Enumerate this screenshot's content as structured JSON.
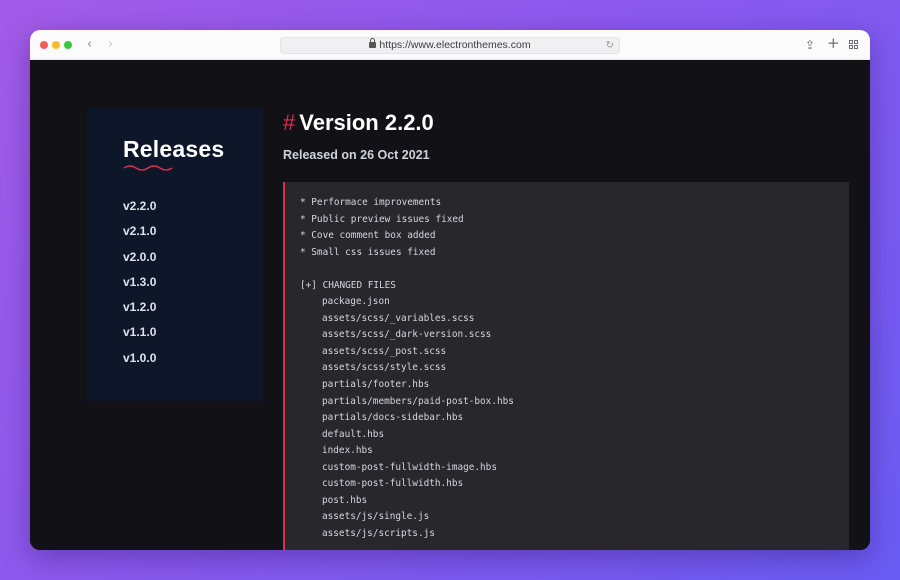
{
  "browser": {
    "url": "https://www.electronthemes.com",
    "back_icon": "‹",
    "forward_icon": "›",
    "reload_icon": "↻",
    "share_icon": "⇪",
    "new_tab_icon": "+"
  },
  "sidebar": {
    "title": "Releases",
    "items": [
      {
        "label": "v2.2.0"
      },
      {
        "label": "v2.1.0"
      },
      {
        "label": "v2.0.0"
      },
      {
        "label": "v1.3.0"
      },
      {
        "label": "v1.2.0"
      },
      {
        "label": "v1.1.0"
      },
      {
        "label": "v1.0.0"
      }
    ]
  },
  "release": {
    "hash": "#",
    "title": "Version 2.2.0",
    "released": "Released on 26 Oct 2021",
    "notes": [
      "* Performace improvements",
      "* Public preview issues fixed",
      "* Cove comment box added",
      "* Small css issues fixed"
    ],
    "changed_header": "[+] CHANGED FILES",
    "files": [
      "package.json",
      "assets/scss/_variables.scss",
      "assets/scss/_dark-version.scss",
      "assets/scss/_post.scss",
      "assets/scss/style.scss",
      "partials/footer.hbs",
      "partials/members/paid-post-box.hbs",
      "partials/docs-sidebar.hbs",
      "default.hbs",
      "index.hbs",
      "custom-post-fullwidth-image.hbs",
      "custom-post-fullwidth.hbs",
      "post.hbs",
      "assets/js/single.js",
      "assets/js/scripts.js"
    ]
  },
  "colors": {
    "accent": "#d9304e",
    "sidebar_bg": "#0d1729",
    "code_bg": "#27272c",
    "page_bg": "#121216"
  }
}
